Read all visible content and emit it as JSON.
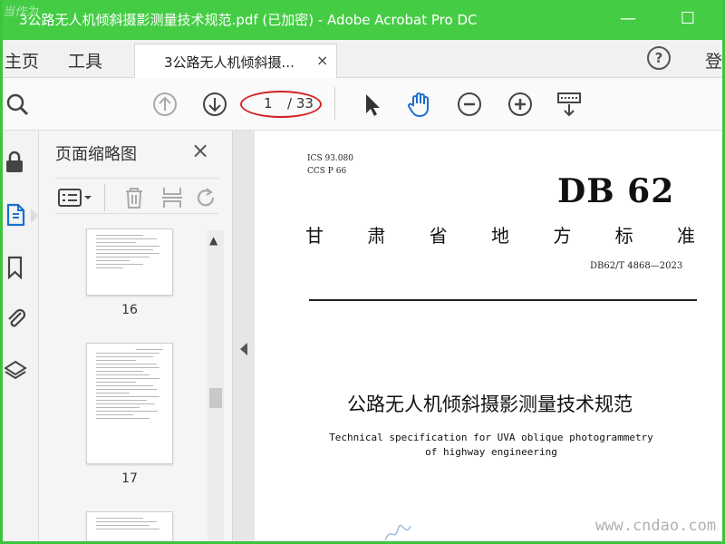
{
  "window": {
    "title": "3公路无人机倾斜摄影测量技术规范.pdf (已加密) - Adobe Acrobat Pro DC",
    "title_watermark": "当作为",
    "minimize_glyph": "—",
    "maximize_glyph": "☐",
    "accent_color": "#45cc45"
  },
  "menu": {
    "home": "主页",
    "tools": "工具",
    "login": "登"
  },
  "tab": {
    "label": "3公路无人机倾斜摄...",
    "close": "×"
  },
  "help": {
    "glyph": "?"
  },
  "toolbar": {
    "page_current": "1",
    "page_total": "/ 33",
    "icons": [
      "zoom-icon",
      "page-up-icon",
      "page-down-icon",
      "select-arrow-icon",
      "hand-icon",
      "zoom-out-icon",
      "zoom-in-icon",
      "marquee-zoom-icon"
    ]
  },
  "sidebar_rail": {
    "icons": [
      "lock-icon",
      "page-thumbnails-icon",
      "bookmark-icon",
      "attachment-icon",
      "layers-icon"
    ]
  },
  "thumbnails": {
    "title": "页面缩略图",
    "close": "×",
    "pages": [
      {
        "label": "16"
      },
      {
        "label": "17"
      },
      {
        "label": ""
      }
    ]
  },
  "document": {
    "ics": "ICS 93.080",
    "ccs": "CCS P 66",
    "db_code": "DB 62",
    "region_chars": [
      "甘",
      "肃",
      "省",
      "地",
      "方",
      "标",
      "准"
    ],
    "standard_number": "DB62/T 4868—2023",
    "title_cn": "公路无人机倾斜摄影测量技术规范",
    "title_en_line1": "Technical specification for UVA oblique photogrammetry",
    "title_en_line2": "of highway engineering"
  },
  "watermark": {
    "site": "www.cndao.com"
  }
}
